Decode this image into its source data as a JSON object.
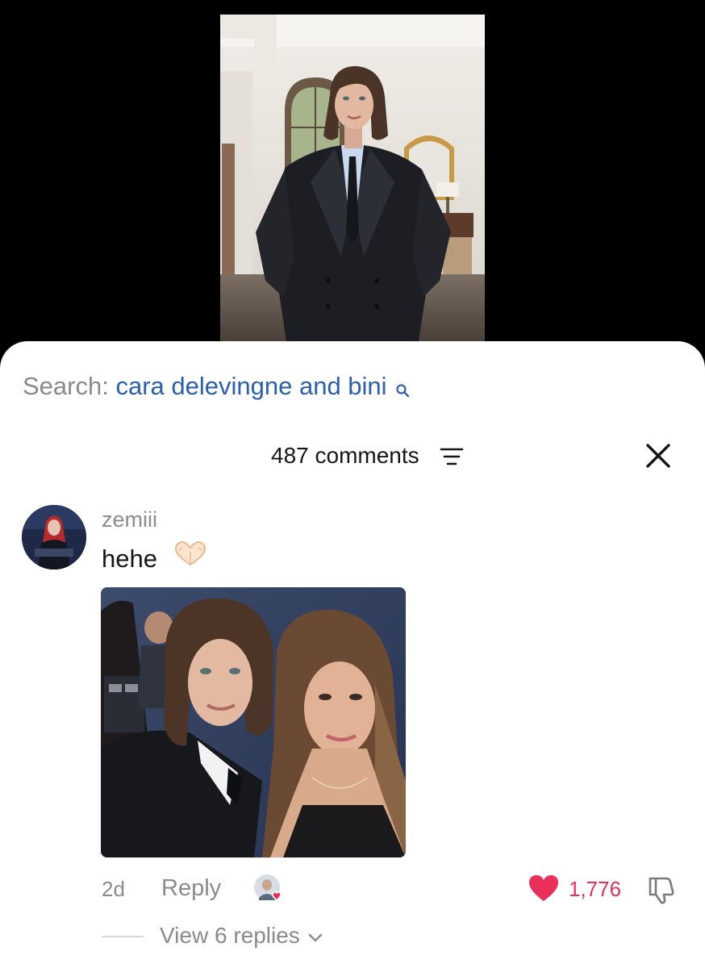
{
  "search": {
    "label": "Search:",
    "query": "cara delevingne and bini",
    "icon": "search-icon"
  },
  "comments_header": {
    "count_label": "487 comments",
    "sort_icon": "sort-icon",
    "close_icon": "close-icon"
  },
  "comment": {
    "username": "zemiii",
    "text": "hehe",
    "emoji": "heart-hands-icon",
    "timestamp": "2d",
    "reply_label": "Reply",
    "like_count": "1,776",
    "view_replies_label": "View 6 replies"
  },
  "colors": {
    "accent_blue": "#2a5fb0",
    "like_red": "#e8305b",
    "muted_gray": "#8b8b8b",
    "text_dark": "#161616"
  }
}
